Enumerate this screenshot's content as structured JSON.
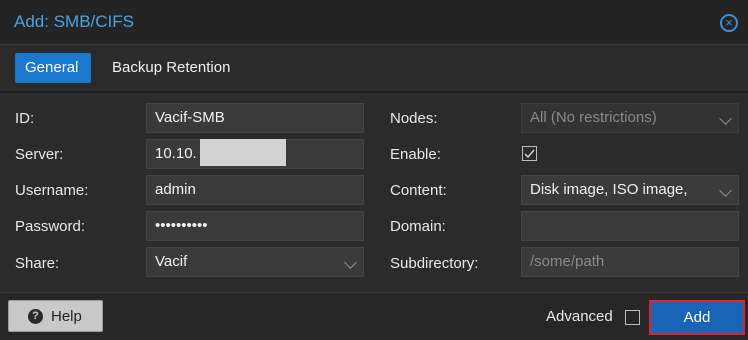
{
  "dialog": {
    "title": "Add: SMB/CIFS",
    "close_icon": "close-circle-icon"
  },
  "tabs": [
    {
      "label": "General",
      "active": true
    },
    {
      "label": "Backup Retention",
      "active": false
    }
  ],
  "left": {
    "id": {
      "label": "ID:",
      "value": "Vacif-SMB"
    },
    "server": {
      "label": "Server:",
      "value": "10.10."
    },
    "username": {
      "label": "Username:",
      "value": "admin"
    },
    "password": {
      "label": "Password:",
      "value": "••••••••••"
    },
    "share": {
      "label": "Share:",
      "value": "Vacif"
    }
  },
  "right": {
    "nodes": {
      "label": "Nodes:",
      "value": "All (No restrictions)"
    },
    "enable": {
      "label": "Enable:",
      "checked": true
    },
    "content": {
      "label": "Content:",
      "value": "Disk image, ISO image,"
    },
    "domain": {
      "label": "Domain:",
      "value": ""
    },
    "subdirectory": {
      "label": "Subdirectory:",
      "placeholder": "/some/path"
    }
  },
  "footer": {
    "help_label": "Help",
    "help_icon": "question-circle-icon",
    "advanced_label": "Advanced",
    "advanced_checked": false,
    "add_label": "Add"
  },
  "colors": {
    "accent": "#1a78d0",
    "title": "#4aa3e3",
    "add_button": "#1a64b8",
    "highlight_border": "#e0222a"
  }
}
